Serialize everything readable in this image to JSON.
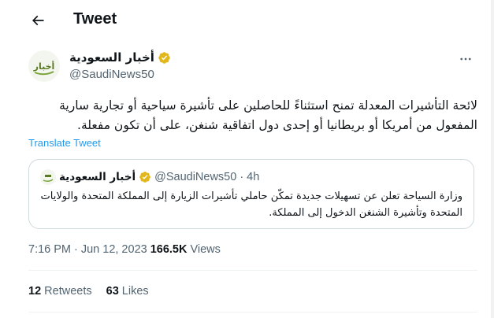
{
  "header": {
    "title": "Tweet"
  },
  "author": {
    "display_name": "أخبار السعودية",
    "handle": "@SaudiNews50",
    "avatar_text": "أخبار",
    "verified_color": "#e2b719"
  },
  "tweet": {
    "text": "لائحة التأشيرات المعدلة تمنح استثناءً للحاصلين على تأشيرة سياحية أو تجارية سارية المفعول من أمريكا أو بريطانيا أو إحدى دول اتفاقية شنغن، على أن تكون مفعلة.",
    "translate_label": "Translate Tweet"
  },
  "quote": {
    "display_name": "أخبار السعودية",
    "handle": "@SaudiNews50",
    "separator": "·",
    "time": "4h",
    "text": "وزارة السياحة تعلن عن تسهيلات جديدة تمكّن حاملي تأشيرات الزيارة إلى المملكة المتحدة والولايات المتحدة وتأشيرة الشنغن الدخول إلى المملكة."
  },
  "meta": {
    "time": "7:16 PM",
    "separator": "·",
    "date": "Jun 12, 2023",
    "views_count": "166.5K",
    "views_label": "Views"
  },
  "stats": {
    "retweets_count": "12",
    "retweets_label": "Retweets",
    "likes_count": "63",
    "likes_label": "Likes"
  },
  "colors": {
    "accent": "#1d9bf0",
    "text_primary": "#0f1419",
    "text_secondary": "#536471",
    "border": "#cfd9de"
  },
  "icons": {
    "back": "arrow-left-icon",
    "more": "more-horizontal-icon",
    "verified": "verified-badge-icon"
  }
}
